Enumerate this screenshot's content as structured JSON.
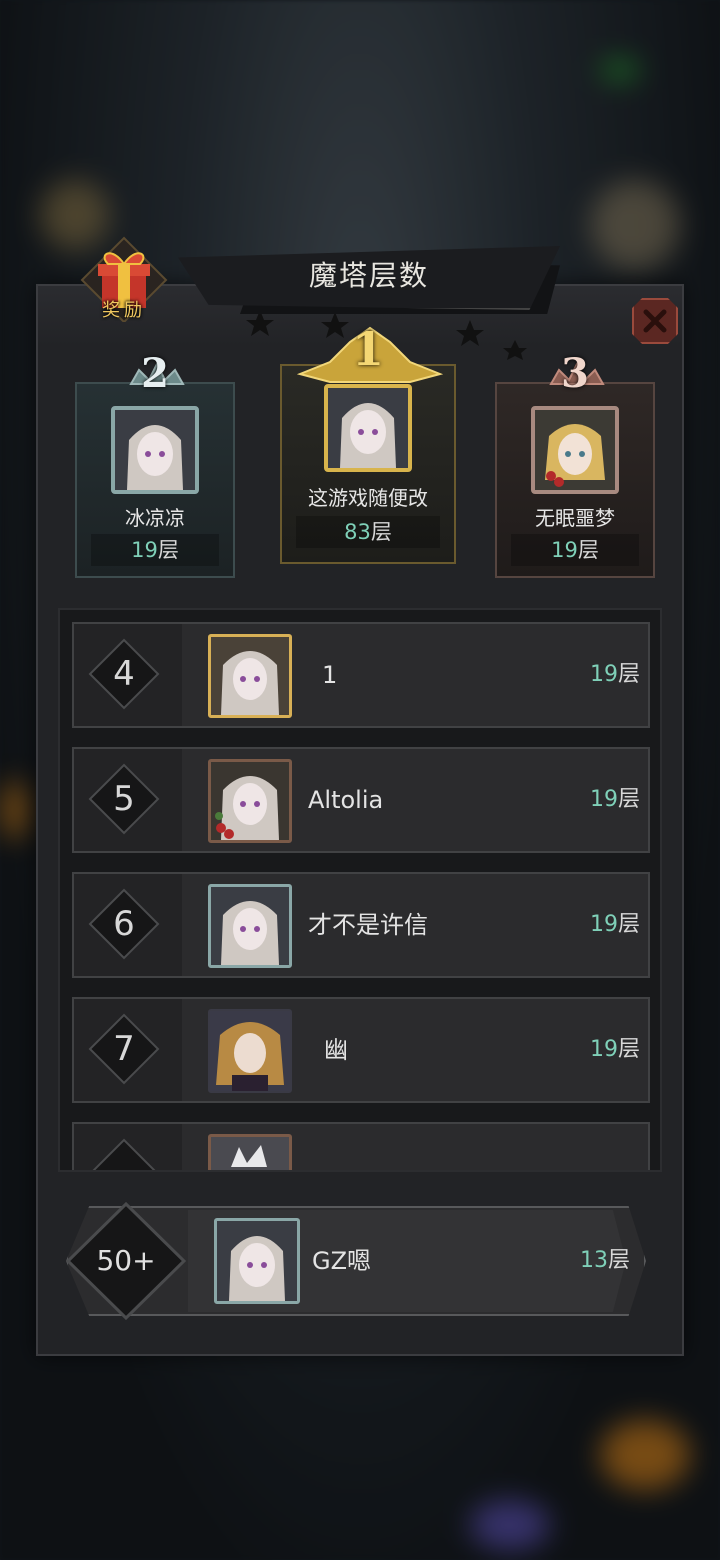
{
  "title": "魔塔层数",
  "reward_label": "奖励",
  "top3": [
    {
      "rank": "2",
      "name": "冰凉凉",
      "floor": "19",
      "unit": "层"
    },
    {
      "rank": "1",
      "name": "这游戏随便改",
      "floor": "83",
      "unit": "层"
    },
    {
      "rank": "3",
      "name": "无眠噩梦",
      "floor": "19",
      "unit": "层"
    }
  ],
  "rows": [
    {
      "rank": "4",
      "name": "1",
      "floor": "19",
      "unit": "层"
    },
    {
      "rank": "5",
      "name": "Altolia",
      "floor": "19",
      "unit": "层"
    },
    {
      "rank": "6",
      "name": "才不是许信",
      "floor": "19",
      "unit": "层"
    },
    {
      "rank": "7",
      "name": "幽",
      "floor": "19",
      "unit": "层"
    }
  ],
  "self": {
    "rank": "50+",
    "name": "GZ嗯",
    "floor": "13",
    "unit": "层"
  },
  "colors": {
    "floor_number": "#7fd0b8",
    "gold": "#d9b54a",
    "panel": "#222326"
  }
}
